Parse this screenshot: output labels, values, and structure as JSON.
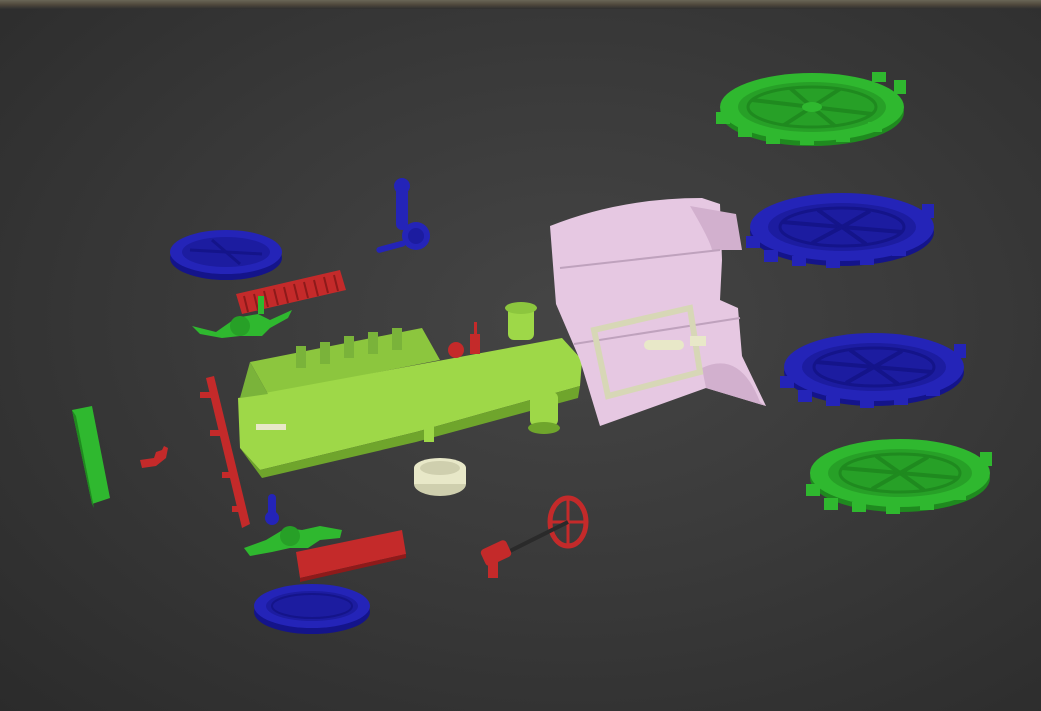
{
  "viewport": {
    "background": "#3a3a3a",
    "view": "3d-perspective-viewport"
  },
  "colors": {
    "green": "#2fb82f",
    "green_dark": "#1f8a1f",
    "blue": "#2424b8",
    "blue_dark": "#14148a",
    "red": "#c42a2a",
    "red_dark": "#8e1a1a",
    "lime": "#9ed848",
    "lime_dark": "#6fa52c",
    "pink": "#e6c8e2",
    "pink_dark": "#bfa2bd",
    "cream": "#e8e8c8"
  },
  "parts": [
    {
      "name": "rear-wheel-green-top",
      "color": "green"
    },
    {
      "name": "rear-wheel-blue-1",
      "color": "blue"
    },
    {
      "name": "rear-wheel-blue-2",
      "color": "blue"
    },
    {
      "name": "rear-wheel-green-bottom",
      "color": "green"
    },
    {
      "name": "front-wheel-blue-top",
      "color": "blue"
    },
    {
      "name": "front-wheel-blue-bottom",
      "color": "blue"
    },
    {
      "name": "boiler-body",
      "color": "lime"
    },
    {
      "name": "cab-housing",
      "color": "pink"
    },
    {
      "name": "steering-wheel",
      "color": "red"
    },
    {
      "name": "front-bumper",
      "color": "green"
    }
  ]
}
